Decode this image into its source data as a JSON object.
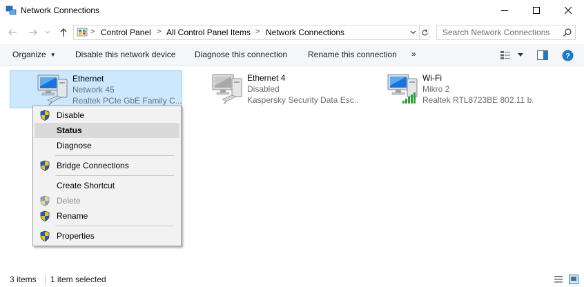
{
  "window": {
    "title": "Network Connections"
  },
  "address": {
    "breadcrumbs": [
      "Control Panel",
      "All Control Panel Items",
      "Network Connections"
    ]
  },
  "search": {
    "placeholder": "Search Network Connections"
  },
  "toolbar": {
    "organize": "Organize",
    "disable": "Disable this network device",
    "diagnose": "Diagnose this connection",
    "rename": "Rename this connection",
    "more": "»"
  },
  "items": [
    {
      "name": "Ethernet",
      "status": "Network 45",
      "device": "Realtek PCIe GbE Family C..."
    },
    {
      "name": "Ethernet 4",
      "status": "Disabled",
      "device": "Kaspersky Security Data Esc..."
    },
    {
      "name": "Wi-Fi",
      "status": "Mikro 2",
      "device": "Realtek RTL8723BE 802.11 b..."
    }
  ],
  "context_menu": {
    "disable": "Disable",
    "status": "Status",
    "diagnose": "Diagnose",
    "bridge": "Bridge Connections",
    "shortcut": "Create Shortcut",
    "delete": "Delete",
    "rename": "Rename",
    "properties": "Properties"
  },
  "statusbar": {
    "count": "3 items",
    "selected": "1 item selected"
  },
  "colors": {
    "selection": "#cce8ff",
    "selection_border": "#99d1ff",
    "help": "#1979ca"
  }
}
